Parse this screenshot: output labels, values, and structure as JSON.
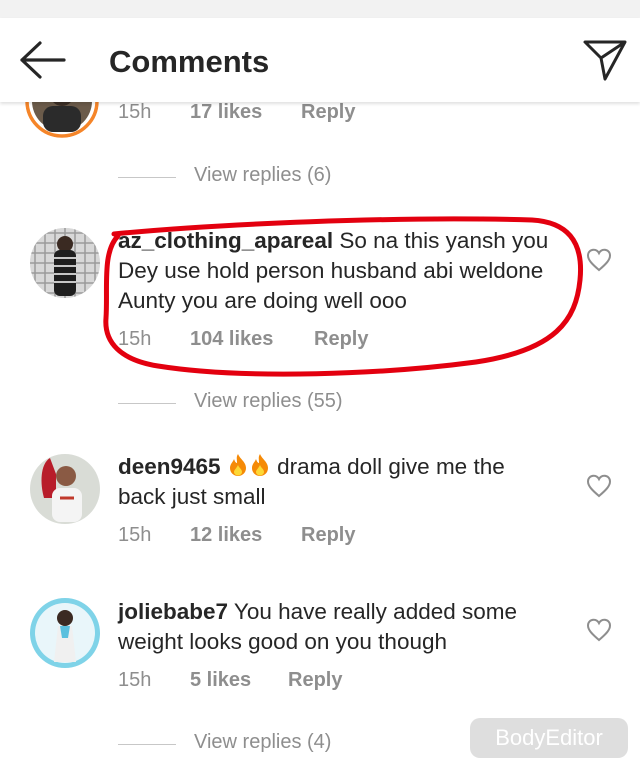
{
  "header": {
    "title": "Comments"
  },
  "comments": [
    {
      "username": "",
      "text": "",
      "time": "15h",
      "likes": "17 likes",
      "reply": "Reply",
      "view_replies": "View replies (6)"
    },
    {
      "username": "az_clothing_apareal",
      "text": "So na this yansh you Dey use hold person husband abi weldone Aunty you are doing well ooo",
      "time": "15h",
      "likes": "104 likes",
      "reply": "Reply",
      "view_replies": "View replies (55)"
    },
    {
      "username": "deen9465",
      "text": "drama doll give me the back just small",
      "time": "15h",
      "likes": "12 likes",
      "reply": "Reply"
    },
    {
      "username": "joliebabe7",
      "text": "You have really added some weight looks good on you though",
      "time": "15h",
      "likes": "5 likes",
      "reply": "Reply",
      "view_replies": "View replies (4)"
    }
  ],
  "watermark": {
    "text": "BodyEditor"
  },
  "icons": {
    "back": "back-arrow-icon",
    "send": "send-icon",
    "heart": "heart-outline-icon",
    "fire": "fire-emoji-icon"
  },
  "colors": {
    "text": "#262626",
    "muted": "#8e8e8e",
    "highlight": "#e3000f",
    "story_ring": "#f58529"
  }
}
